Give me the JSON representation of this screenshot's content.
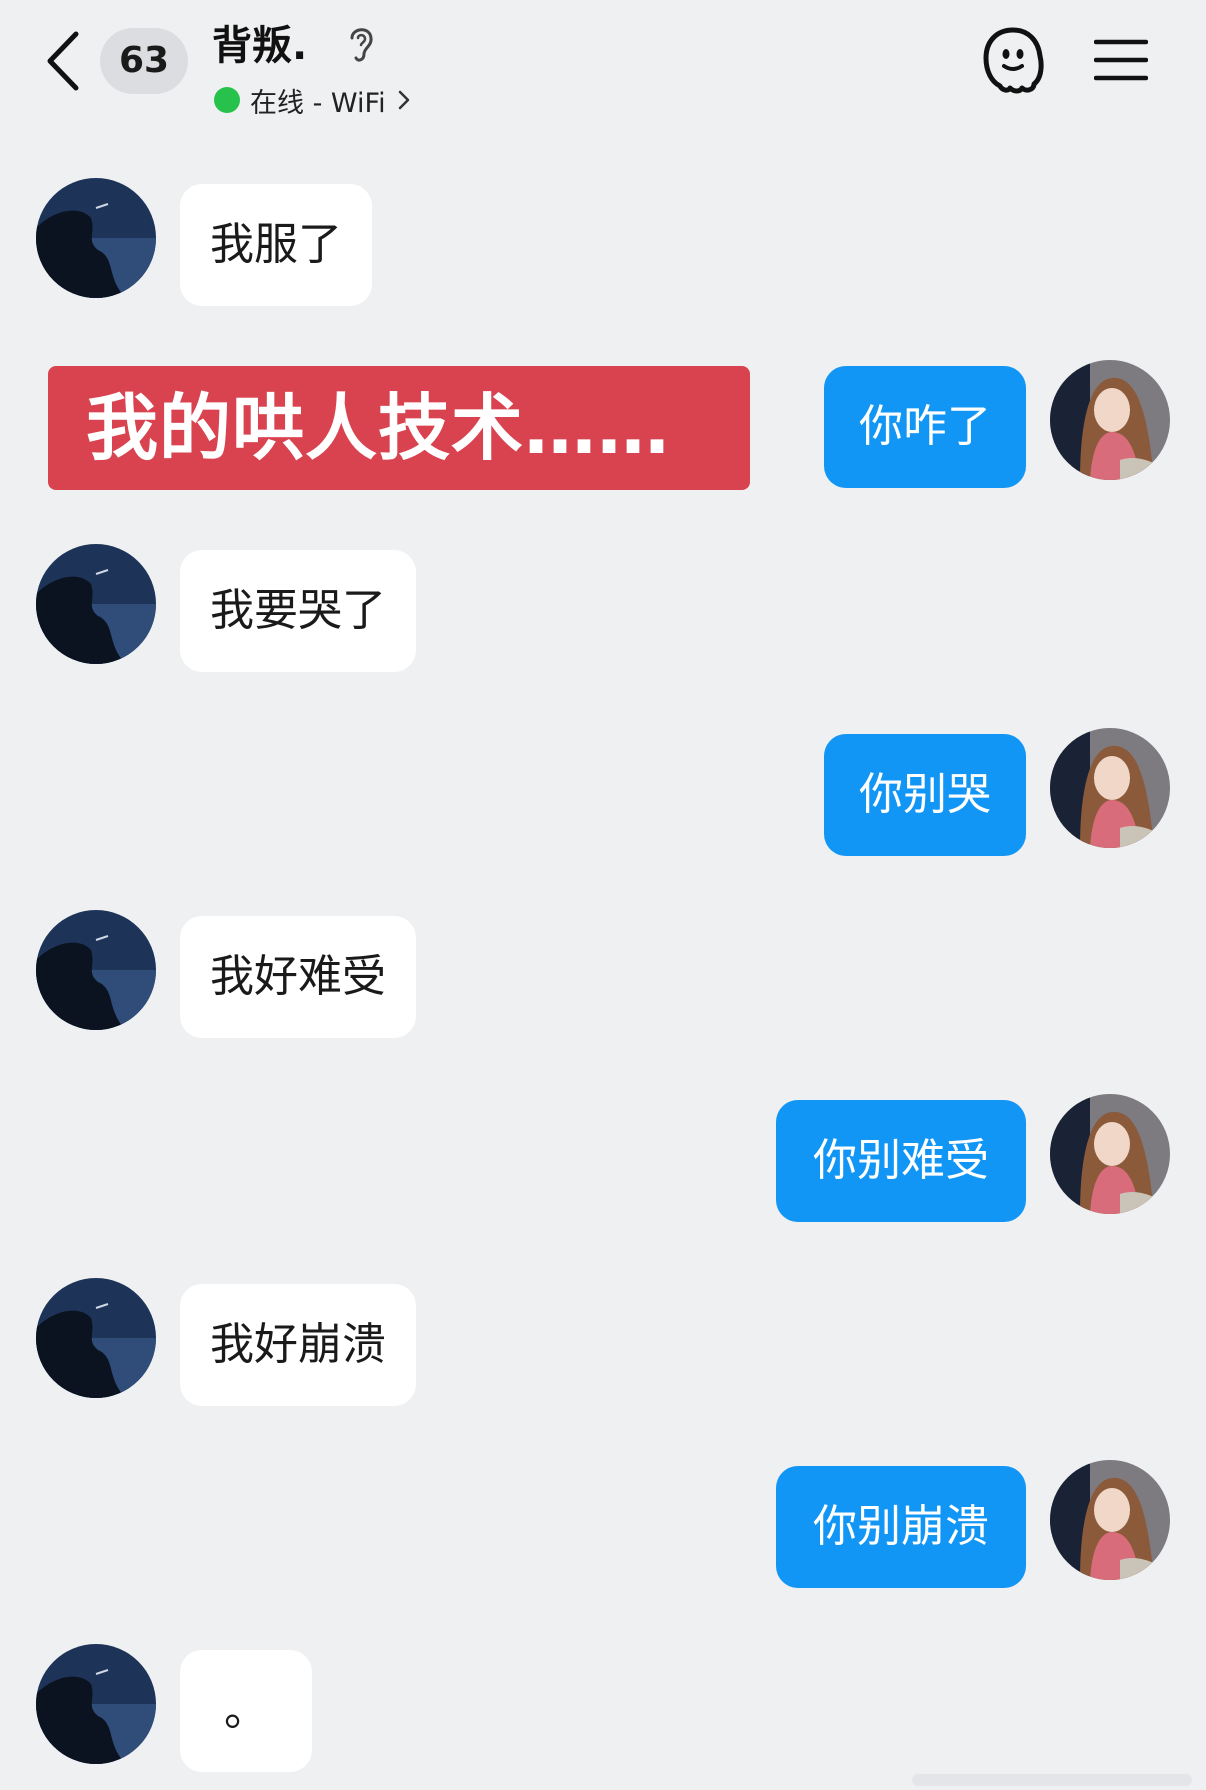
{
  "header": {
    "unread_count": "63",
    "contact_name": "背叛.",
    "status_text": "在线 - WiFi",
    "icons": [
      "back-arrow-icon",
      "ear-icon",
      "online-dot-icon",
      "chevron-right-icon",
      "emoji-ghost-icon",
      "menu-icon"
    ]
  },
  "caption": "我的哄人技术……",
  "messages": [
    {
      "side": "in",
      "text": "我服了"
    },
    {
      "side": "out",
      "text": "你咋了"
    },
    {
      "side": "in",
      "text": "我要哭了"
    },
    {
      "side": "out",
      "text": "你别哭"
    },
    {
      "side": "in",
      "text": "我好难受"
    },
    {
      "side": "out",
      "text": "你别难受"
    },
    {
      "side": "in",
      "text": "我好崩溃"
    },
    {
      "side": "out",
      "text": "你别崩溃"
    },
    {
      "side": "in",
      "text": "。"
    }
  ],
  "colors": {
    "background": "#eff0f2",
    "outgoing_bubble": "#1296f6",
    "incoming_bubble": "#ffffff",
    "online_dot": "#27c24c",
    "caption_background": "#d9434f"
  }
}
